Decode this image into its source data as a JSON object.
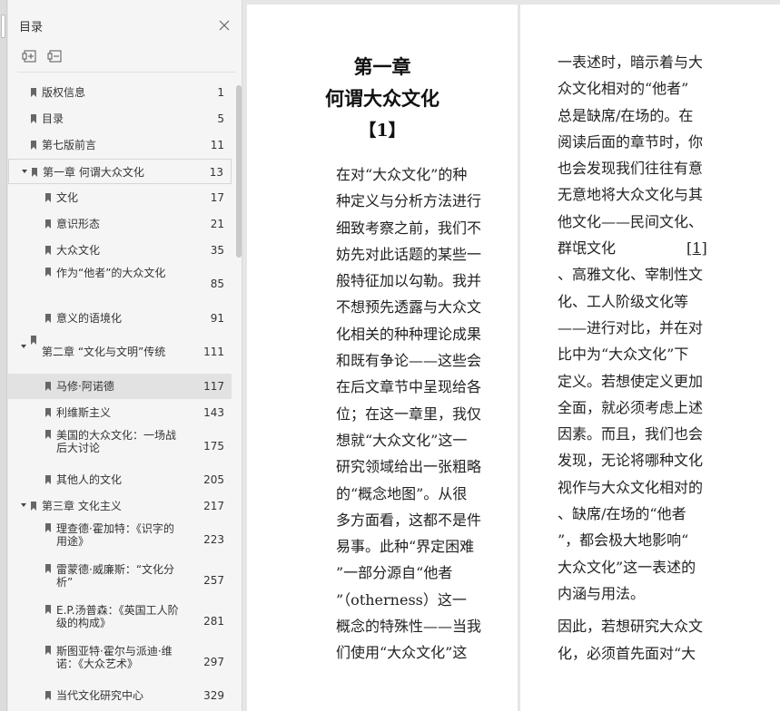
{
  "sidebar": {
    "title": "目录",
    "items": [
      {
        "label": "版权信息",
        "page": "1",
        "level": 0
      },
      {
        "label": "目录",
        "page": "5",
        "level": 0
      },
      {
        "label": "第七版前言",
        "page": "11",
        "level": 0
      },
      {
        "label": "第一章 何谓大众文化",
        "page": "13",
        "level": 0,
        "expanded": true
      },
      {
        "label": "文化",
        "page": "17",
        "level": 1
      },
      {
        "label": "意识形态",
        "page": "21",
        "level": 1
      },
      {
        "label": "大众文化",
        "page": "35",
        "level": 1
      },
      {
        "label": "作为“他者”的大众文化",
        "page": "85",
        "level": 1
      },
      {
        "label": "意义的语境化",
        "page": "91",
        "level": 1
      },
      {
        "label": "第二章 “文化与文明”传统",
        "page": "111",
        "level": 0,
        "expanded": true
      },
      {
        "label": "马修·阿诺德",
        "page": "117",
        "level": 1,
        "selected": true
      },
      {
        "label": "利维斯主义",
        "page": "143",
        "level": 1
      },
      {
        "label": "美国的大众文化：一场战后大讨论",
        "page": "175",
        "level": 1
      },
      {
        "label": "其他人的文化",
        "page": "205",
        "level": 1
      },
      {
        "label": "第三章 文化主义",
        "page": "217",
        "level": 0,
        "expanded": true
      },
      {
        "label": "理查德·霍加特：《识字的用途》",
        "page": "223",
        "level": 1
      },
      {
        "label": "雷蒙德·威廉斯：“文化分析”",
        "page": "257",
        "level": 1
      },
      {
        "label": "E.P.汤普森：《英国工人阶级的构成》",
        "page": "281",
        "level": 1
      },
      {
        "label": "斯图亚特·霍尔与派迪·维诺：《大众艺术》",
        "page": "297",
        "level": 1
      },
      {
        "label": "当代文化研究中心",
        "page": "329",
        "level": 1
      }
    ]
  },
  "chapter": {
    "number": "第一章",
    "title": "何谓大众文化",
    "note": "【1】"
  },
  "left_text": [
    "在对“大众文化”的种",
    "种定义与分析方法进行",
    "细致考察之前，我们不",
    "妨先对此话题的某些一",
    "般特征加以勾勒。我并",
    "不想预先透露与大众文",
    "化相关的种种理论成果",
    "和既有争论——这些会",
    "在后文章节中呈现给各",
    "位；在这一章里，我仅",
    "想就“大众文化”这一",
    "研究领域给出一张粗略",
    "的“概念地图”。从很",
    "多方面看，这都不是件",
    "易事。此种“界定困难",
    "”一部分源自“他者",
    "”（otherness）这一",
    "概念的特殊性——当我",
    "们使用“大众文化”这"
  ],
  "right_text": [
    "一表述时，暗示着与大",
    "众文化相对的“他者”",
    "总是缺席/在场的。在",
    "阅读后面的章节时，你",
    "也会发现我们往往有意",
    "无意地将大众文化与其",
    "他文化——民间文化、",
    "群氓文化",
    "、高雅文化、宰制性文",
    "化、工人阶级文化等",
    "——进行对比，并在对",
    "比中为“大众文化”下",
    "定义。若想使定义更加",
    "全面，就必须考虑上述",
    "因素。而且，我们也会",
    "发现，无论将哪种文化",
    "视作与大众文化相对的",
    "、缺席/在场的“他者",
    "”，都会极大地影响“",
    "大众文化”这一表述的",
    "内涵与用法。"
  ],
  "right_footref": "[1]",
  "right_para2": [
    "因此，若想研究大众文",
    "化，必须首先面对“大"
  ],
  "icons": {
    "close": "close-icon",
    "expand_all": "expand-all-icon",
    "collapse_all": "collapse-all-icon",
    "bookmark": "bookmark-icon",
    "arrow": "expand-arrow-icon"
  }
}
